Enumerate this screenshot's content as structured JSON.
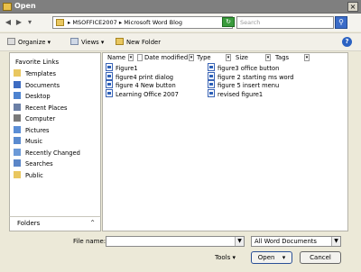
{
  "window": {
    "title": "Open",
    "close": "×"
  },
  "address": {
    "path": [
      "MSOFFICE2007",
      "Microsoft Word Blog"
    ],
    "separator": "▸",
    "search_placeholder": "Search"
  },
  "toolbar": {
    "organize": "Organize",
    "views": "Views",
    "new_folder": "New Folder"
  },
  "sidebar": {
    "title": "Favorite Links",
    "items": [
      {
        "label": "Templates",
        "icon": "folder-icon",
        "color": "#e9c760"
      },
      {
        "label": "Documents",
        "icon": "documents-icon",
        "color": "#3e6cc2"
      },
      {
        "label": "Desktop",
        "icon": "desktop-icon",
        "color": "#4d83d0"
      },
      {
        "label": "Recent Places",
        "icon": "recent-places-icon",
        "color": "#6b7fa6"
      },
      {
        "label": "Computer",
        "icon": "computer-icon",
        "color": "#7a7a7a"
      },
      {
        "label": "Pictures",
        "icon": "pictures-icon",
        "color": "#5b8ed6"
      },
      {
        "label": "Music",
        "icon": "music-icon",
        "color": "#5a8bd0"
      },
      {
        "label": "Recently Changed",
        "icon": "recently-changed-icon",
        "color": "#6c9ad8"
      },
      {
        "label": "Searches",
        "icon": "searches-icon",
        "color": "#5b86c8"
      },
      {
        "label": "Public",
        "icon": "public-folder-icon",
        "color": "#e9c760"
      }
    ],
    "folders_label": "Folders"
  },
  "columns": [
    "Name",
    "Date modified",
    "Type",
    "Size",
    "Tags"
  ],
  "files": [
    "Figure1",
    "figure4 print dialog",
    "figure 4 New button",
    "Learning Office 2007",
    "figure3 office button",
    "figure 2 starting ms word",
    "figure 5 insert menu",
    "revised figure1"
  ],
  "bottom": {
    "file_name_label": "File name:",
    "file_name_value": "",
    "file_type": "All Word Documents",
    "tools": "Tools",
    "open": "Open",
    "cancel": "Cancel"
  }
}
